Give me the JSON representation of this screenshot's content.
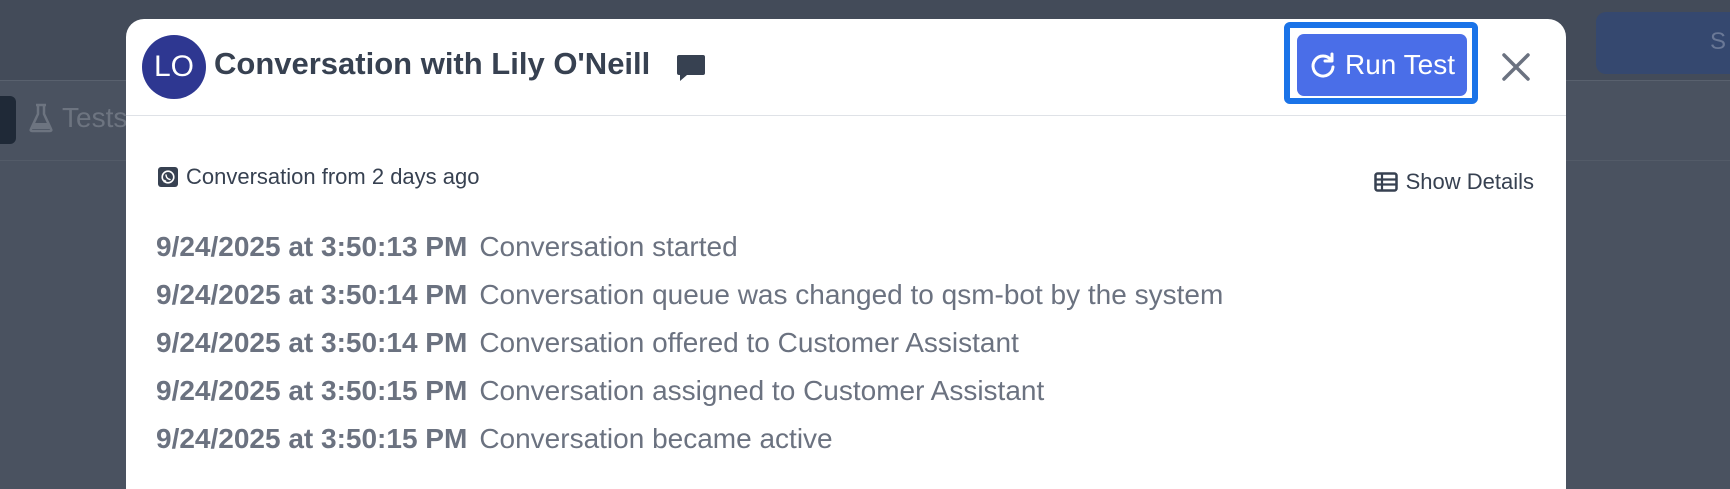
{
  "background": {
    "top_button_label": "S",
    "tab_label": "Tests"
  },
  "modal": {
    "avatar_initials": "LO",
    "title": "Conversation with Lily O'Neill",
    "run_test_label": "Run Test",
    "conversation_info": "Conversation from 2 days ago",
    "show_details_label": "Show Details",
    "events": [
      {
        "timestamp": "9/24/2025 at 3:50:13 PM",
        "description": "Conversation started"
      },
      {
        "timestamp": "9/24/2025 at 3:50:14 PM",
        "description": "Conversation queue was changed to qsm-bot by the system"
      },
      {
        "timestamp": "9/24/2025 at 3:50:14 PM",
        "description": "Conversation offered to Customer Assistant"
      },
      {
        "timestamp": "9/24/2025 at 3:50:15 PM",
        "description": "Conversation assigned to Customer Assistant"
      },
      {
        "timestamp": "9/24/2025 at 3:50:15 PM",
        "description": "Conversation became active"
      }
    ]
  },
  "colors": {
    "overlay_bg": "#4a5260",
    "avatar_bg": "#2e3791",
    "primary_button": "#4a6ee8",
    "focus_ring": "#1a73e8",
    "text_dark": "#374151",
    "text_muted": "#6b7280"
  },
  "icons": {
    "title_icon": "chat-bubble-icon",
    "run_test_icon": "refresh-icon",
    "close_icon": "close-icon",
    "channel_icon": "whatsapp-icon",
    "details_icon": "table-list-icon",
    "tab_icon": "flask-icon"
  }
}
